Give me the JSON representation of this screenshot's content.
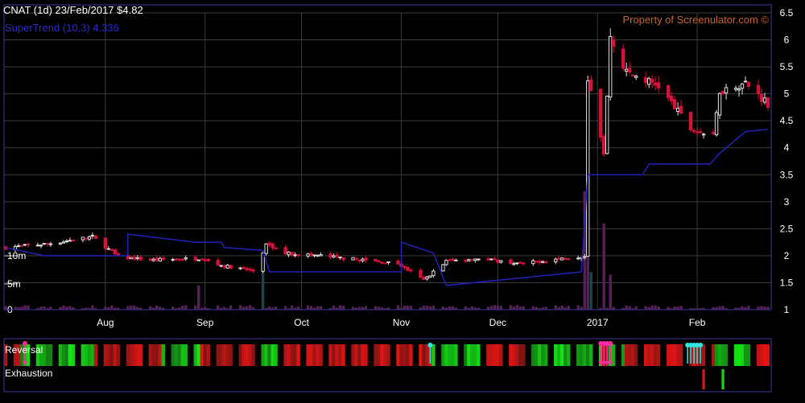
{
  "header": {
    "title": "CNAT (1d) 23/Feb/2017 $4.82",
    "indicator": "SuperTrend (10,3) 4.336",
    "watermark": "Property of Screenulator.com ©"
  },
  "panels": {
    "reversal_label": "Reversal",
    "exhaustion_label": "Exhaustion"
  },
  "colors": {
    "background": "#000000",
    "frame": "#3a3aa0",
    "grid": "#3c3c3c",
    "up": "#e0e0e0",
    "down": "#d2143c",
    "supertrend": "#2222bb",
    "title": "#ffffff",
    "indicator": "#2a2ad0",
    "watermark": "#c8642a",
    "volume": "#5a1f5a",
    "volume_alt": "#144a4a",
    "green": "#1fd11f",
    "red": "#d01818",
    "magenta_arrow": "#ff2aa0",
    "cyan_arrow": "#2ee8e0"
  },
  "chart_data": {
    "type": "candlestick",
    "y_axis": {
      "min": 1,
      "max": 6.5,
      "ticks": [
        "6.5",
        "6",
        "5.5",
        "5",
        "4.5",
        "4",
        "3.5",
        "3",
        "2.5",
        "2",
        "1.5",
        "1"
      ]
    },
    "volume_axis": {
      "ticks": [
        "10m",
        "5m",
        "0"
      ]
    },
    "x_ticks": [
      "Aug",
      "Sep",
      "Oct",
      "Nov",
      "Dec",
      "2017",
      "Feb"
    ],
    "x_tick_dates": [
      "2016-08-01",
      "2016-09-01",
      "2016-10-01",
      "2016-11-01",
      "2016-12-01",
      "2017-01-01",
      "2017-02-01"
    ],
    "date_range": [
      "2016-07-01",
      "2017-02-23"
    ],
    "price_path": [
      [
        "2016-07-01",
        2.15
      ],
      [
        "2016-07-14",
        2.22
      ],
      [
        "2016-07-28",
        2.35
      ],
      [
        "2016-08-05",
        1.98
      ],
      [
        "2016-08-15",
        1.92
      ],
      [
        "2016-08-30",
        1.95
      ],
      [
        "2016-09-06",
        1.82
      ],
      [
        "2016-09-16",
        1.72
      ],
      [
        "2016-09-20",
        2.2
      ],
      [
        "2016-09-26",
        2.05
      ],
      [
        "2016-10-07",
        2.0
      ],
      [
        "2016-10-20",
        1.92
      ],
      [
        "2016-10-31",
        1.85
      ],
      [
        "2016-11-08",
        1.55
      ],
      [
        "2016-11-15",
        1.9
      ],
      [
        "2016-11-25",
        1.95
      ],
      [
        "2016-12-08",
        1.85
      ],
      [
        "2016-12-21",
        1.95
      ],
      [
        "2016-12-28",
        2.0
      ],
      [
        "2016-12-29",
        5.3
      ],
      [
        "2017-01-03",
        3.9
      ],
      [
        "2017-01-05",
        6.0
      ],
      [
        "2017-01-10",
        5.4
      ],
      [
        "2017-01-16",
        5.25
      ],
      [
        "2017-01-20",
        5.15
      ],
      [
        "2017-01-30",
        4.35
      ],
      [
        "2017-02-06",
        4.2
      ],
      [
        "2017-02-08",
        5.05
      ],
      [
        "2017-02-16",
        5.2
      ],
      [
        "2017-02-23",
        4.82
      ]
    ],
    "supertrend": [
      [
        "2016-07-01",
        2.15
      ],
      [
        "2016-07-13",
        2.0
      ],
      [
        "2016-08-08",
        2.0
      ],
      [
        "2016-08-08",
        2.4
      ],
      [
        "2016-08-29",
        2.25
      ],
      [
        "2016-09-06",
        2.25
      ],
      [
        "2016-09-07",
        2.15
      ],
      [
        "2016-09-19",
        2.1
      ],
      [
        "2016-09-21",
        1.7
      ],
      [
        "2016-11-01",
        1.7
      ],
      [
        "2016-11-01",
        2.25
      ],
      [
        "2016-11-11",
        2.05
      ],
      [
        "2016-11-15",
        1.45
      ],
      [
        "2016-12-27",
        1.7
      ],
      [
        "2016-12-29",
        3.5
      ],
      [
        "2017-01-15",
        3.5
      ],
      [
        "2017-01-17",
        3.7
      ],
      [
        "2017-02-05",
        3.7
      ],
      [
        "2017-02-08",
        3.9
      ],
      [
        "2017-02-16",
        4.3
      ],
      [
        "2017-02-23",
        4.34
      ]
    ],
    "volume_peaks": [
      [
        "2016-08-30",
        4.5
      ],
      [
        "2016-09-19",
        9.5
      ],
      [
        "2016-12-28",
        22
      ],
      [
        "2016-12-29",
        26
      ],
      [
        "2016-12-30",
        7
      ],
      [
        "2017-01-03",
        16
      ],
      [
        "2017-01-05",
        6.5
      ]
    ],
    "reversal_markers": [
      {
        "type": "down",
        "date": "2016-07-07"
      },
      {
        "type": "up",
        "date": "2016-11-10"
      },
      {
        "type": "down",
        "date": "2017-01-02"
      },
      {
        "type": "down",
        "date": "2017-01-03"
      },
      {
        "type": "down",
        "date": "2017-01-04"
      },
      {
        "type": "down",
        "date": "2017-01-05"
      },
      {
        "type": "up",
        "date": "2017-01-29"
      },
      {
        "type": "up",
        "date": "2017-01-30"
      },
      {
        "type": "up",
        "date": "2017-01-31"
      },
      {
        "type": "up",
        "date": "2017-02-01"
      },
      {
        "type": "up",
        "date": "2017-02-02"
      }
    ]
  }
}
